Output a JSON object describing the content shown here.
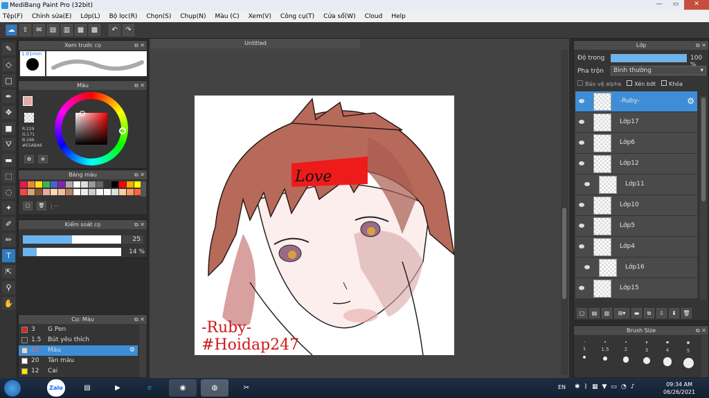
{
  "window": {
    "title": "MediBang Paint Pro (32bit)",
    "minimize": "—",
    "maximize": "▭",
    "close": "✕"
  },
  "menu": [
    "Tệp(F)",
    "Chỉnh sửa(E)",
    "Lớp(L)",
    "Bộ lọc(R)",
    "Chọn(S)",
    "Chụp(N)",
    "Màu (C)",
    "Xem(V)",
    "Công cụ(T)",
    "Cửa sổ(W)",
    "Cloud",
    "Help"
  ],
  "document": {
    "tab_title": "Untitled",
    "caption_line1": "-Ruby-",
    "caption_line2": "#Hoidap247",
    "headband_text": "Love"
  },
  "brush_preview": {
    "title": "Xem trước cọ",
    "size": "1.81mm"
  },
  "color_panel": {
    "title": "Màu",
    "r": "R:229",
    "g": "G:171",
    "b": "B:166",
    "hex": "#E5ABA6",
    "primary_color": "#e5aba6"
  },
  "palette": {
    "title": "Bảng màu",
    "colors": [
      "#e6194b",
      "#f58231",
      "#ffe119",
      "#3cb44b",
      "#4363d8",
      "#911eb4",
      "#aaaaaa",
      "#ffffff",
      "#dddddd",
      "#999999",
      "#666666",
      "#333333",
      "#000000",
      "#ff0000",
      "#ffaa00",
      "#ffff00",
      "#ff4444",
      "#d2a679",
      "#8b5a2b",
      "#e5aba6",
      "#ffd8b1",
      "#f0c0a0",
      "#c08060",
      "#ffffff",
      "#eeeeee",
      "#cccccc",
      "#f5f5f5",
      "#fafafa",
      "#e0e0e0",
      "#ffcc99",
      "#ff9966",
      "#ff6633"
    ],
    "footer": "| ---"
  },
  "brush_control": {
    "title": "Kiểm soát cọ",
    "size_value": "25",
    "opacity_value": "14 %",
    "size_fraction": 0.5,
    "opacity_fraction": 0.14
  },
  "brush_list": {
    "title": "Cọ: Màu",
    "items": [
      {
        "size": "3",
        "name": "G Pen",
        "color": "#e02020"
      },
      {
        "size": "1.5",
        "name": "Bút yêu thích",
        "color": "#3a3a3a"
      },
      {
        "size": "25",
        "name": "Màu",
        "color": "#d9d9d9",
        "selected": true
      },
      {
        "size": "20",
        "name": "Tán màu",
        "color": "#ffffff"
      },
      {
        "size": "12",
        "name": "Cai",
        "color": "#ffe400"
      }
    ]
  },
  "layer_panel": {
    "title": "Lớp",
    "opacity_label": "Độ trong",
    "opacity_value": "100 %",
    "blend_label": "Pha trộn",
    "blend_value": "Bình thường",
    "protect_alpha": "Bảo vệ alpha",
    "clipping": "Xén bớt",
    "lock": "Khóa",
    "layers": [
      {
        "name": "-Ruby-",
        "selected": true
      },
      {
        "name": "Lớp17"
      },
      {
        "name": "Lớp6"
      },
      {
        "name": "Lớp12"
      },
      {
        "name": "Lớp11",
        "sub": true
      },
      {
        "name": "Lớp10"
      },
      {
        "name": "Lớp5"
      },
      {
        "name": "Lớp4"
      },
      {
        "name": "Lớp16",
        "sub": true
      },
      {
        "name": "Lớp15"
      }
    ]
  },
  "brush_size_panel": {
    "title": "Brush Size",
    "sizes": [
      "1",
      "1.5",
      "2",
      "3",
      "4",
      "5"
    ]
  },
  "taskbar": {
    "language": "EN",
    "time": "09:34 AM",
    "date": "06/26/2021",
    "zalo_label": "Zalo"
  }
}
